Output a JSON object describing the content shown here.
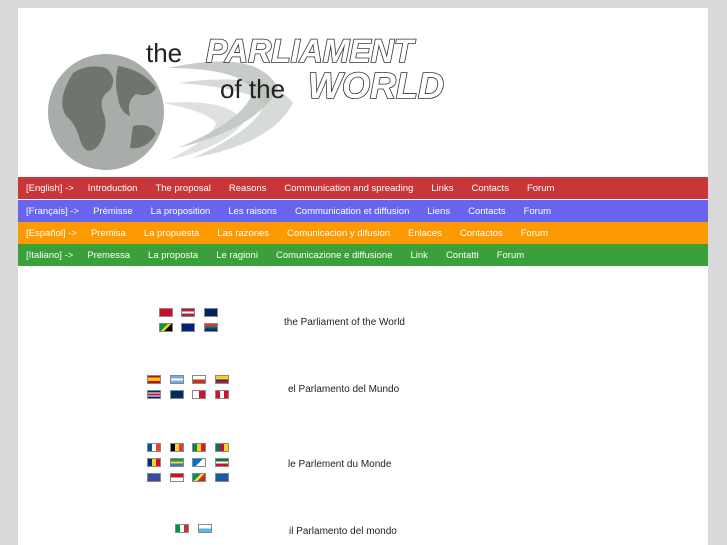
{
  "header": {
    "title_line1_prefix": "the",
    "title_line1_main": "PARLIAMENT",
    "title_line2_prefix": "of the",
    "title_line2_main": "WORLD"
  },
  "nav_rows": [
    {
      "name": "english",
      "lang": "[English] ->",
      "items": [
        "Introduction",
        "The proposal",
        "Reasons",
        "Communication and spreading",
        "Links",
        "Contacts",
        "Forum"
      ]
    },
    {
      "name": "francais",
      "lang": "[Français] ->",
      "items": [
        "Prémisse",
        "La proposition",
        "Les raisons",
        "Communication et diffusion",
        "Liens",
        "Contacts",
        "Forum"
      ]
    },
    {
      "name": "espanol",
      "lang": "[Español] ->",
      "items": [
        "Premisa",
        "La propuesta",
        "Las razones",
        "Comunicacion y difusion",
        "Enlaces",
        "Contactos",
        "Forum"
      ]
    },
    {
      "name": "italiano",
      "lang": "[Italiano] ->",
      "items": [
        "Premessa",
        "La proposta",
        "Le ragioni",
        "Comunicazione e diffusione",
        "Link",
        "Contatti",
        "Forum"
      ]
    }
  ],
  "languages": [
    {
      "label": "the Parliament of the World"
    },
    {
      "label": "el Parlamento del Mundo"
    },
    {
      "label": "le Parlement du Monde"
    },
    {
      "label": "il Parlamento del mondo"
    }
  ],
  "colors": {
    "english": "#c9363a",
    "francais": "#6765ee",
    "espanol": "#fd9a01",
    "italiano": "#3aa03a"
  }
}
